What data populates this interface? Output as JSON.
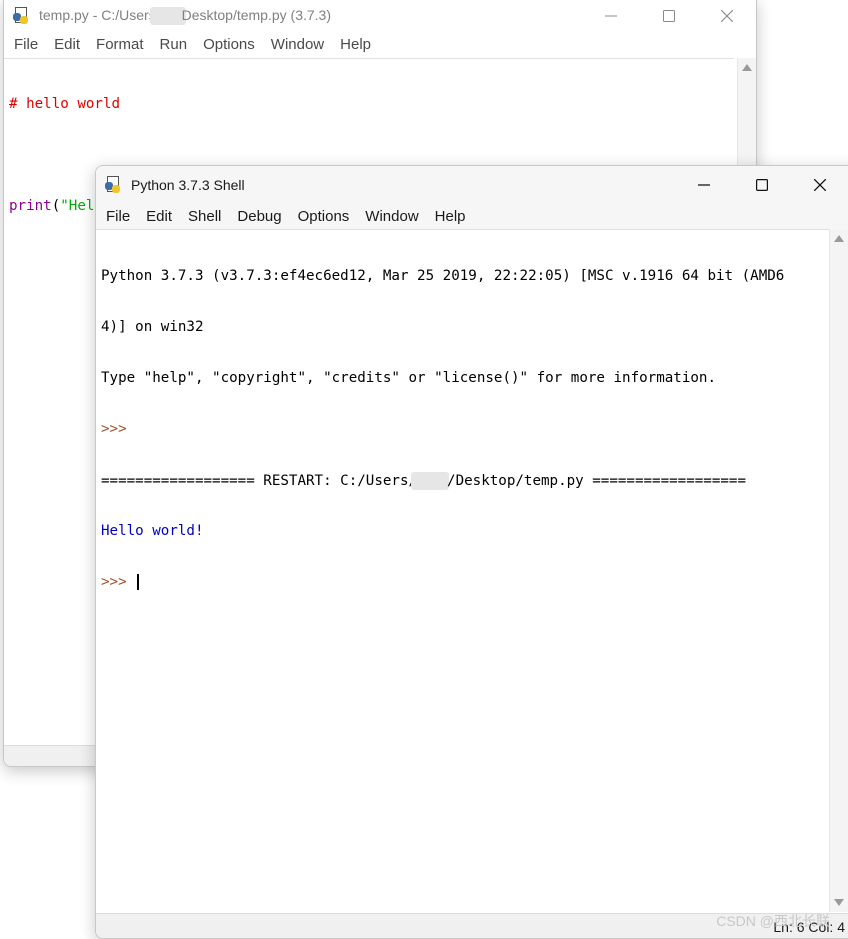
{
  "editor_window": {
    "title_prefix": "temp.py - C:/Users/",
    "title_suffix": "Desktop/temp.py (3.7.3)",
    "menu": [
      "File",
      "Edit",
      "Format",
      "Run",
      "Options",
      "Window",
      "Help"
    ],
    "code": {
      "comment": "# hello world",
      "call_name": "print",
      "open_paren": "(",
      "string": "\"Hello world!\"",
      "close_paren": ")"
    }
  },
  "shell_window": {
    "title": "Python 3.7.3 Shell",
    "menu": [
      "File",
      "Edit",
      "Shell",
      "Debug",
      "Options",
      "Window",
      "Help"
    ],
    "lines": {
      "banner_1": "Python 3.7.3 (v3.7.3:ef4ec6ed12, Mar 25 2019, 22:22:05) [MSC v.1916 64 bit (AMD6",
      "banner_2": "4)] on win32",
      "banner_3": "Type \"help\", \"copyright\", \"credits\" or \"license()\" for more information.",
      "prompt_1": ">>>",
      "restart_prefix": "================== RESTART: C:/Users/",
      "restart_suffix": "/Desktop/temp.py ==================",
      "output": "Hello world!",
      "prompt_2": ">>> "
    },
    "status": "Ln: 6  Col: 4"
  },
  "watermark": "CSDN @西北长联",
  "icons": [
    "python-idle-icon",
    "minimize-icon",
    "maximize-icon",
    "close-icon",
    "scroll-up-arrow-icon",
    "scroll-down-arrow-icon"
  ]
}
